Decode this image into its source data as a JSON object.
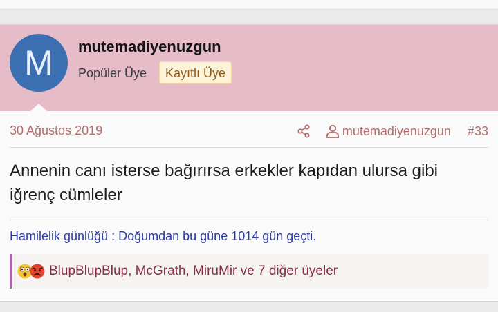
{
  "post": {
    "author": {
      "avatar_letter": "M",
      "username": "mutemadiyenuzgun",
      "title": "Popüler Üye",
      "badge": "Kayıtlı Üye"
    },
    "meta": {
      "date": "30 Ağustos 2019",
      "author_link": "mutemadiyenuzgun",
      "post_number": "#33"
    },
    "message": "Annenin canı isterse bağırırsa erkekler kapıdan ulursa gibi iğrenç cümleler",
    "signature": "Hamilelik günlüğü : Doğumdan bu güne 1014 gün geçti.",
    "reactions": {
      "icons": [
        "shocked-face-icon",
        "angry-face-icon"
      ],
      "text": "BlupBlupBlup, McGrath, MiruMir ve 7 diğer üyeler"
    }
  },
  "colors": {
    "header_bg": "#e6bcc8",
    "avatar_bg": "#3b6fb2",
    "meta_text": "#b46b6b",
    "signature_text": "#2d3aa8",
    "reaction_text": "#8a2d45",
    "reaction_border": "#b45fb0"
  }
}
